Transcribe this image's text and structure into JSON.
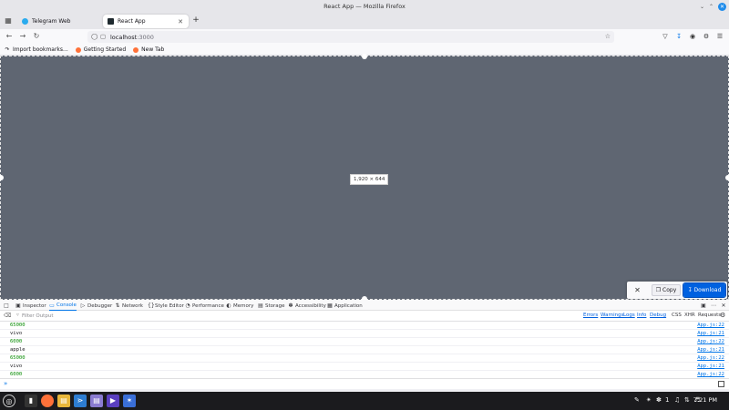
{
  "window": {
    "title": "React App — Mozilla Firefox"
  },
  "tabs": [
    {
      "title": "Telegram Web",
      "active": false
    },
    {
      "title": "React App",
      "active": true
    }
  ],
  "address": {
    "host": "localhost",
    "port": ":3000"
  },
  "bookmarks": [
    "Import bookmarks...",
    "Getting Started",
    "New Tab"
  ],
  "screenshot": {
    "dimensions": "1,920 × 644",
    "copy_label": "Copy",
    "download_label": "Download"
  },
  "devtools": {
    "tabs": [
      "Inspector",
      "Console",
      "Debugger",
      "Network",
      "Style Editor",
      "Performance",
      "Memory",
      "Storage",
      "Accessibility",
      "Application"
    ],
    "active_tab": "Console",
    "filter_placeholder": "Filter Output",
    "levels": [
      "Errors",
      "Warnings",
      "Logs",
      "Info",
      "Debug"
    ],
    "extra_filters": [
      "CSS",
      "XHR",
      "Requests"
    ],
    "logs": [
      {
        "message": "65000",
        "source": "App.js:22"
      },
      {
        "message": "vivo",
        "source": "App.js:21"
      },
      {
        "message": "6000",
        "source": "App.js:22"
      },
      {
        "message": "apple",
        "source": "App.js:21"
      },
      {
        "message": "65000",
        "source": "App.js:22"
      },
      {
        "message": "vivo",
        "source": "App.js:21"
      },
      {
        "message": "6000",
        "source": "App.js:22"
      }
    ]
  },
  "taskbar": {
    "time": "7:21 PM",
    "volume_level": "1"
  },
  "colors": {
    "accent": "#0061e0",
    "link": "#0074e8",
    "number": "#058b00",
    "viewport": "#5f6672"
  }
}
